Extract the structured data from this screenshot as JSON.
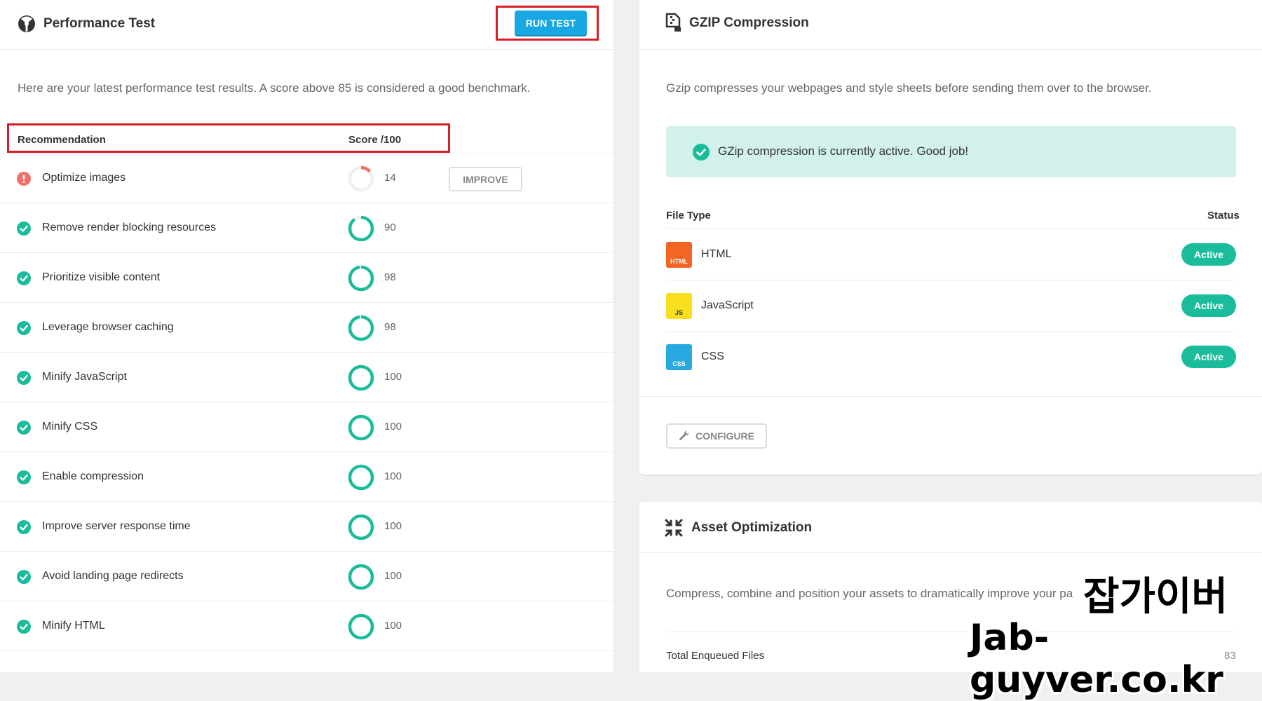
{
  "performance": {
    "title": "Performance Test",
    "run_button": "RUN TEST",
    "description": "Here are your latest performance test results. A score above 85 is considered a good benchmark.",
    "col_recommendation": "Recommendation",
    "col_score": "Score /100",
    "improve_button": "IMPROVE",
    "rows": [
      {
        "label": "Optimize images",
        "score": 14,
        "status": "warning"
      },
      {
        "label": "Remove render blocking resources",
        "score": 90,
        "status": "ok"
      },
      {
        "label": "Prioritize visible content",
        "score": 98,
        "status": "ok"
      },
      {
        "label": "Leverage browser caching",
        "score": 98,
        "status": "ok"
      },
      {
        "label": "Minify JavaScript",
        "score": 100,
        "status": "ok"
      },
      {
        "label": "Minify CSS",
        "score": 100,
        "status": "ok"
      },
      {
        "label": "Enable compression",
        "score": 100,
        "status": "ok"
      },
      {
        "label": "Improve server response time",
        "score": 100,
        "status": "ok"
      },
      {
        "label": "Avoid landing page redirects",
        "score": 100,
        "status": "ok"
      },
      {
        "label": "Minify HTML",
        "score": 100,
        "status": "ok"
      }
    ]
  },
  "gzip": {
    "title": "GZIP Compression",
    "description": "Gzip compresses your webpages and style sheets before sending them over to the browser.",
    "notice": "GZip compression is currently active. Good job!",
    "col_file_type": "File Type",
    "col_status": "Status",
    "files": [
      {
        "name": "HTML",
        "icon_text": "HTML",
        "status": "Active"
      },
      {
        "name": "JavaScript",
        "icon_text": "JS",
        "status": "Active"
      },
      {
        "name": "CSS",
        "icon_text": "CSS",
        "status": "Active"
      }
    ],
    "configure_button": "CONFIGURE"
  },
  "asset": {
    "title": "Asset Optimization",
    "description": "Compress, combine and position your assets to dramatically improve your pa",
    "total_label": "Total Enqueued Files",
    "total_value": "83"
  },
  "watermark": {
    "korean": "잡가이버",
    "url": "Jab-guyver.co.kr"
  },
  "colors": {
    "accent_blue": "#17a8e3",
    "success_green": "#1abc9c",
    "warning_red": "#f0716b",
    "highlight_outline": "#d81e25",
    "notice_bg": "#d1f1ea",
    "html_icon": "#f26522",
    "js_icon": "#f7df1e",
    "css_icon": "#29a9e1"
  }
}
